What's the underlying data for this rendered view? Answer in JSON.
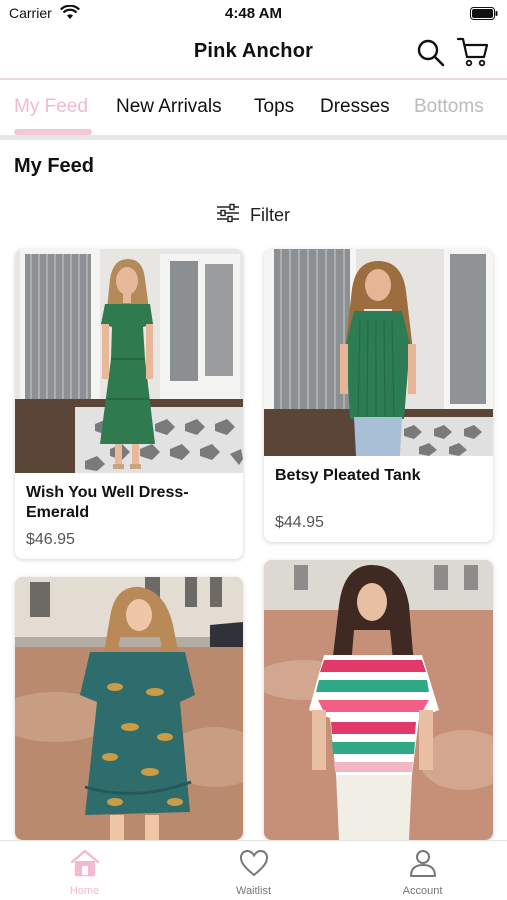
{
  "status": {
    "carrier": "Carrier",
    "time": "4:48 AM"
  },
  "header": {
    "title": "Pink Anchor"
  },
  "tabs": [
    {
      "label": "My Feed",
      "active": true
    },
    {
      "label": "New Arrivals"
    },
    {
      "label": "Tops"
    },
    {
      "label": "Dresses"
    },
    {
      "label": "Bottoms"
    }
  ],
  "feed": {
    "title": "My Feed",
    "filter_label": "Filter"
  },
  "products": [
    {
      "name": "Wish You Well Dress-Emerald",
      "price": "$46.95",
      "image": "green-tiered-dress-photo"
    },
    {
      "name": "Betsy Pleated Tank",
      "price": "$44.95",
      "image": "green-pleated-tank-photo"
    },
    {
      "name": "",
      "price": "",
      "image": "teal-cheetah-print-dress-photo"
    },
    {
      "name": "",
      "price": "",
      "image": "striped-top-photo"
    }
  ],
  "tab_bar": [
    {
      "label": "Home",
      "icon": "home-icon",
      "active": true
    },
    {
      "label": "Waitlist",
      "icon": "heart-icon"
    },
    {
      "label": "Account",
      "icon": "person-icon"
    }
  ],
  "colors": {
    "accent_pink": "#f3b9d0",
    "indicator": "#f3c6d8",
    "text": "#111111"
  }
}
